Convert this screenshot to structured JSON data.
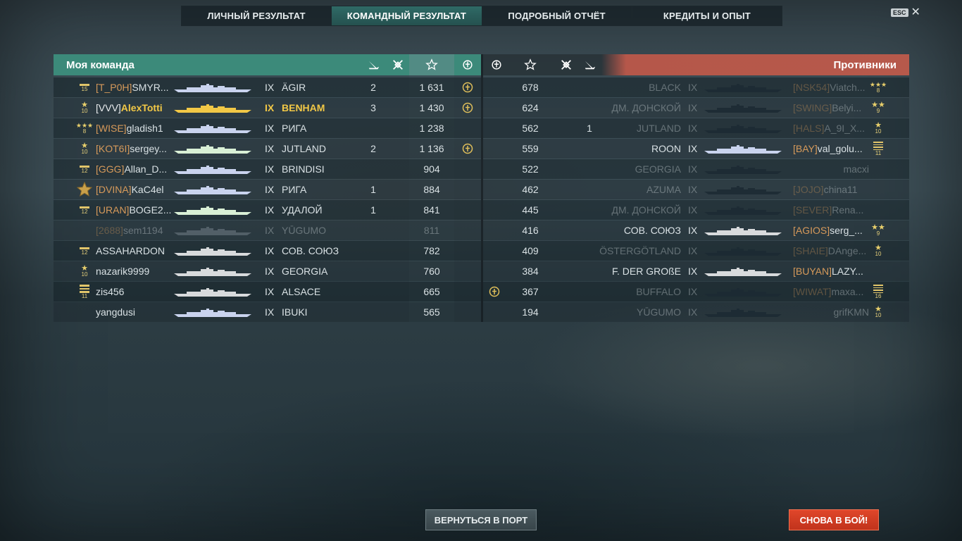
{
  "tabs": [
    {
      "label": "ЛИЧНЫЙ РЕЗУЛЬТАТ",
      "active": false
    },
    {
      "label": "КОМАНДНЫЙ РЕЗУЛЬТАТ",
      "active": true
    },
    {
      "label": "ПОДРОБНЫЙ ОТЧЁТ",
      "active": false
    },
    {
      "label": "КРЕДИТЫ И ОПЫТ",
      "active": false
    }
  ],
  "esc_label": "ESC",
  "close_icon": "✕",
  "my_team": {
    "title": "Моя команда",
    "rows": [
      {
        "rank_icon": "rank-bar",
        "rank": "15",
        "clan": "[T_P0H]",
        "name": "SMYR...",
        "tier": "IX",
        "ship": "ÄGIR",
        "kills": "2",
        "planes": "",
        "xp": "1 631",
        "medal": true,
        "me": false,
        "dim": false,
        "ship_color": "#c9d3ee"
      },
      {
        "rank_icon": "rank-star",
        "rank": "10",
        "clan": "[VVV]",
        "name": "AlexTotti",
        "tier": "IX",
        "ship": "BENHAM",
        "kills": "3",
        "planes": "",
        "xp": "1 430",
        "medal": true,
        "me": true,
        "dim": false,
        "ship_color": "#f2c846"
      },
      {
        "rank_icon": "rank-3star",
        "rank": "8",
        "clan": "[WISE]",
        "name": "gladish1",
        "tier": "IX",
        "ship": "РИГА",
        "kills": "",
        "planes": "",
        "xp": "1 238",
        "medal": false,
        "me": false,
        "dim": false,
        "ship_color": "#c9d3ee"
      },
      {
        "rank_icon": "rank-star",
        "rank": "10",
        "clan": "[KOT6I]",
        "name": "sergey...",
        "tier": "IX",
        "ship": "JUTLAND",
        "kills": "2",
        "planes": "",
        "xp": "1 136",
        "medal": true,
        "me": false,
        "dim": false,
        "ship_color": "#d9f0d6"
      },
      {
        "rank_icon": "rank-bar",
        "rank": "12",
        "clan": "[GGG]",
        "name": "Allan_D...",
        "tier": "IX",
        "ship": "BRINDISI",
        "kills": "",
        "planes": "",
        "xp": "904",
        "medal": false,
        "me": false,
        "dim": false,
        "ship_color": "#c9d3ee"
      },
      {
        "rank_icon": "rank-medal",
        "rank": "",
        "clan": "[DVINA]",
        "name": "KaC4el",
        "tier": "IX",
        "ship": "РИГА",
        "kills": "1",
        "planes": "",
        "xp": "884",
        "medal": false,
        "me": false,
        "dim": false,
        "ship_color": "#c9d3ee"
      },
      {
        "rank_icon": "rank-bar",
        "rank": "12",
        "clan": "[URAN]",
        "name": "BOGE2...",
        "tier": "IX",
        "ship": "УДАЛОЙ",
        "kills": "1",
        "planes": "",
        "xp": "841",
        "medal": false,
        "me": false,
        "dim": false,
        "ship_color": "#d9f0d6"
      },
      {
        "rank_icon": "",
        "rank": "",
        "clan": "[2688]",
        "name": "sem1194",
        "tier": "IX",
        "ship": "YŪGUMO",
        "kills": "",
        "planes": "",
        "xp": "811",
        "medal": false,
        "me": false,
        "dim": true,
        "ship_color": "#9aa7b0"
      },
      {
        "rank_icon": "rank-bar",
        "rank": "12",
        "clan": "",
        "name": "ASSAHARDON",
        "tier": "IX",
        "ship": "СОВ. СОЮЗ",
        "kills": "",
        "planes": "",
        "xp": "782",
        "medal": false,
        "me": false,
        "dim": false,
        "ship_color": "#d8dadc"
      },
      {
        "rank_icon": "rank-star",
        "rank": "10",
        "clan": "",
        "name": "nazarik9999",
        "tier": "IX",
        "ship": "GEORGIA",
        "kills": "",
        "planes": "",
        "xp": "760",
        "medal": false,
        "me": false,
        "dim": false,
        "ship_color": "#d8dadc"
      },
      {
        "rank_icon": "rank-bar3",
        "rank": "11",
        "clan": "",
        "name": "zis456",
        "tier": "IX",
        "ship": "ALSACE",
        "kills": "",
        "planes": "",
        "xp": "665",
        "medal": false,
        "me": false,
        "dim": false,
        "ship_color": "#d8dadc"
      },
      {
        "rank_icon": "",
        "rank": "",
        "clan": "",
        "name": "yangdusi",
        "tier": "IX",
        "ship": "IBUKI",
        "kills": "",
        "planes": "",
        "xp": "565",
        "medal": false,
        "me": false,
        "dim": false,
        "ship_color": "#c9d3ee"
      }
    ]
  },
  "enemy_team": {
    "title": "Противники",
    "rows": [
      {
        "medal": false,
        "xp": "678",
        "planes": "",
        "kills": "",
        "ship": "BLACK",
        "tier": "IX",
        "clan": "[NSK54]",
        "name": "Viatch...",
        "rank_icon": "rank-3star",
        "rank": "8",
        "dim": true,
        "ship_color": "#1c2a33"
      },
      {
        "medal": false,
        "xp": "624",
        "planes": "",
        "kills": "",
        "ship": "ДМ. ДОНСКОЙ",
        "tier": "IX",
        "clan": "[SWING]",
        "name": "Belyi...",
        "rank_icon": "rank-2star",
        "rank": "9",
        "dim": true,
        "ship_color": "#1c2a33"
      },
      {
        "medal": false,
        "xp": "562",
        "planes": "1",
        "kills": "",
        "ship": "JUTLAND",
        "tier": "IX",
        "clan": "[HALS]",
        "name": "A_9I_X...",
        "rank_icon": "rank-star",
        "rank": "10",
        "dim": true,
        "ship_color": "#1c2a33"
      },
      {
        "medal": false,
        "xp": "559",
        "planes": "",
        "kills": "",
        "ship": "ROON",
        "tier": "IX",
        "clan": "[BAY]",
        "name": "val_golu...",
        "rank_icon": "rank-bar4",
        "rank": "11",
        "dim": false,
        "ship_color": "#c9d3ee"
      },
      {
        "medal": false,
        "xp": "522",
        "planes": "",
        "kills": "",
        "ship": "GEORGIA",
        "tier": "IX",
        "clan": "",
        "name": "macxi",
        "rank_icon": "",
        "rank": "",
        "dim": true,
        "ship_color": "#1c2a33"
      },
      {
        "medal": false,
        "xp": "462",
        "planes": "",
        "kills": "",
        "ship": "AZUMA",
        "tier": "IX",
        "clan": "[JOJO]",
        "name": "china11",
        "rank_icon": "",
        "rank": "",
        "dim": true,
        "ship_color": "#1c2a33"
      },
      {
        "medal": false,
        "xp": "445",
        "planes": "",
        "kills": "",
        "ship": "ДМ. ДОНСКОЙ",
        "tier": "IX",
        "clan": "[SEVER]",
        "name": "Rena...",
        "rank_icon": "",
        "rank": "",
        "dim": true,
        "ship_color": "#1c2a33"
      },
      {
        "medal": false,
        "xp": "416",
        "planes": "",
        "kills": "",
        "ship": "СОВ. СОЮЗ",
        "tier": "IX",
        "clan": "[AGIOS]",
        "name": "serg_...",
        "rank_icon": "rank-2star",
        "rank": "9",
        "dim": false,
        "ship_color": "#d8dadc"
      },
      {
        "medal": false,
        "xp": "409",
        "planes": "",
        "kills": "",
        "ship": "ÖSTERGÖTLAND",
        "tier": "IX",
        "clan": "[SHAIE]",
        "name": "DAnge...",
        "rank_icon": "rank-star",
        "rank": "10",
        "dim": true,
        "ship_color": "#1c2a33"
      },
      {
        "medal": false,
        "xp": "384",
        "planes": "",
        "kills": "",
        "ship": "F. DER GROßE",
        "tier": "IX",
        "clan": "[BUYAN]",
        "name": "LAZY...",
        "rank_icon": "",
        "rank": "",
        "dim": false,
        "ship_color": "#d8dadc"
      },
      {
        "medal": true,
        "xp": "367",
        "planes": "",
        "kills": "",
        "ship": "BUFFALO",
        "tier": "IX",
        "clan": "[WIWAT]",
        "name": "maxa...",
        "rank_icon": "rank-bar4",
        "rank": "16",
        "dim": true,
        "ship_color": "#1c2a33"
      },
      {
        "medal": false,
        "xp": "194",
        "planes": "",
        "kills": "",
        "ship": "YŪGUMO",
        "tier": "IX",
        "clan": "",
        "name": "grifKMN",
        "rank_icon": "rank-star",
        "rank": "10",
        "dim": true,
        "ship_color": "#1c2a33"
      }
    ]
  },
  "buttons": {
    "port": "ВЕРНУТЬСЯ В ПОРТ",
    "battle": "СНОВА В БОЙ!"
  },
  "colors": {
    "team_header": "#3c8a7a",
    "enemy_header": "#b6594b",
    "player_highlight": "#f2c846",
    "clan_tag": "#d79a5a",
    "battle_button": "#d53c22"
  }
}
